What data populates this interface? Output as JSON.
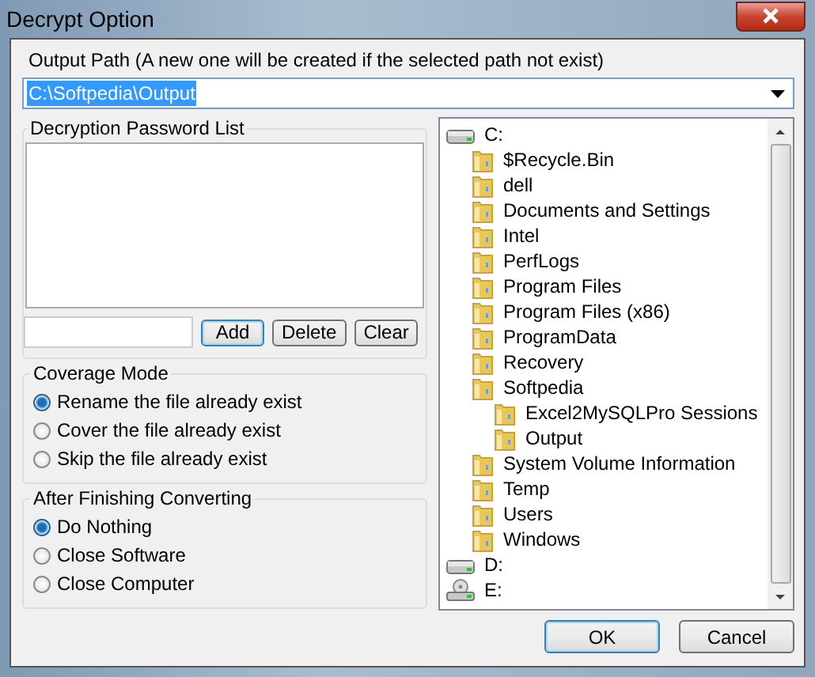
{
  "window": {
    "title": "Decrypt Option"
  },
  "output_path": {
    "label": "Output Path (A new one will be created if the selected path not exist)",
    "value": "C:\\Softpedia\\Output",
    "highlighted": true
  },
  "password_list": {
    "title": "Decryption Password List",
    "buttons": [
      {
        "label": "Add",
        "default": true
      },
      {
        "label": "Delete",
        "default": false
      },
      {
        "label": "Clear",
        "default": false
      }
    ]
  },
  "coverage_mode": {
    "title": "Coverage Mode",
    "options": [
      {
        "label": "Rename the file already exist",
        "selected": true
      },
      {
        "label": "Cover the file already exist",
        "selected": false
      },
      {
        "label": "Skip the file already exist",
        "selected": false
      }
    ]
  },
  "after_finishing": {
    "title": "After Finishing Converting",
    "options": [
      {
        "label": "Do Nothing",
        "selected": true
      },
      {
        "label": "Close Software",
        "selected": false
      },
      {
        "label": "Close Computer",
        "selected": false
      }
    ]
  },
  "folder_tree": [
    {
      "kind": "drive",
      "label": "C:",
      "children": [
        {
          "kind": "folder",
          "label": "$Recycle.Bin"
        },
        {
          "kind": "folder",
          "label": "dell"
        },
        {
          "kind": "folder",
          "label": "Documents and Settings"
        },
        {
          "kind": "folder",
          "label": "Intel"
        },
        {
          "kind": "folder",
          "label": "PerfLogs"
        },
        {
          "kind": "folder",
          "label": "Program Files"
        },
        {
          "kind": "folder",
          "label": "Program Files (x86)"
        },
        {
          "kind": "folder",
          "label": "ProgramData"
        },
        {
          "kind": "folder",
          "label": "Recovery"
        },
        {
          "kind": "folder",
          "label": "Softpedia",
          "children": [
            {
              "kind": "folder",
              "label": "Excel2MySQLPro Sessions"
            },
            {
              "kind": "folder",
              "label": "Output"
            }
          ]
        },
        {
          "kind": "folder",
          "label": "System Volume Information"
        },
        {
          "kind": "folder",
          "label": "Temp"
        },
        {
          "kind": "folder",
          "label": "Users"
        },
        {
          "kind": "folder",
          "label": "Windows"
        }
      ]
    },
    {
      "kind": "drive",
      "label": "D:"
    },
    {
      "kind": "disc",
      "label": "E:"
    }
  ],
  "buttons": [
    {
      "label": "OK",
      "default": true
    },
    {
      "label": "Cancel",
      "default": false
    }
  ]
}
